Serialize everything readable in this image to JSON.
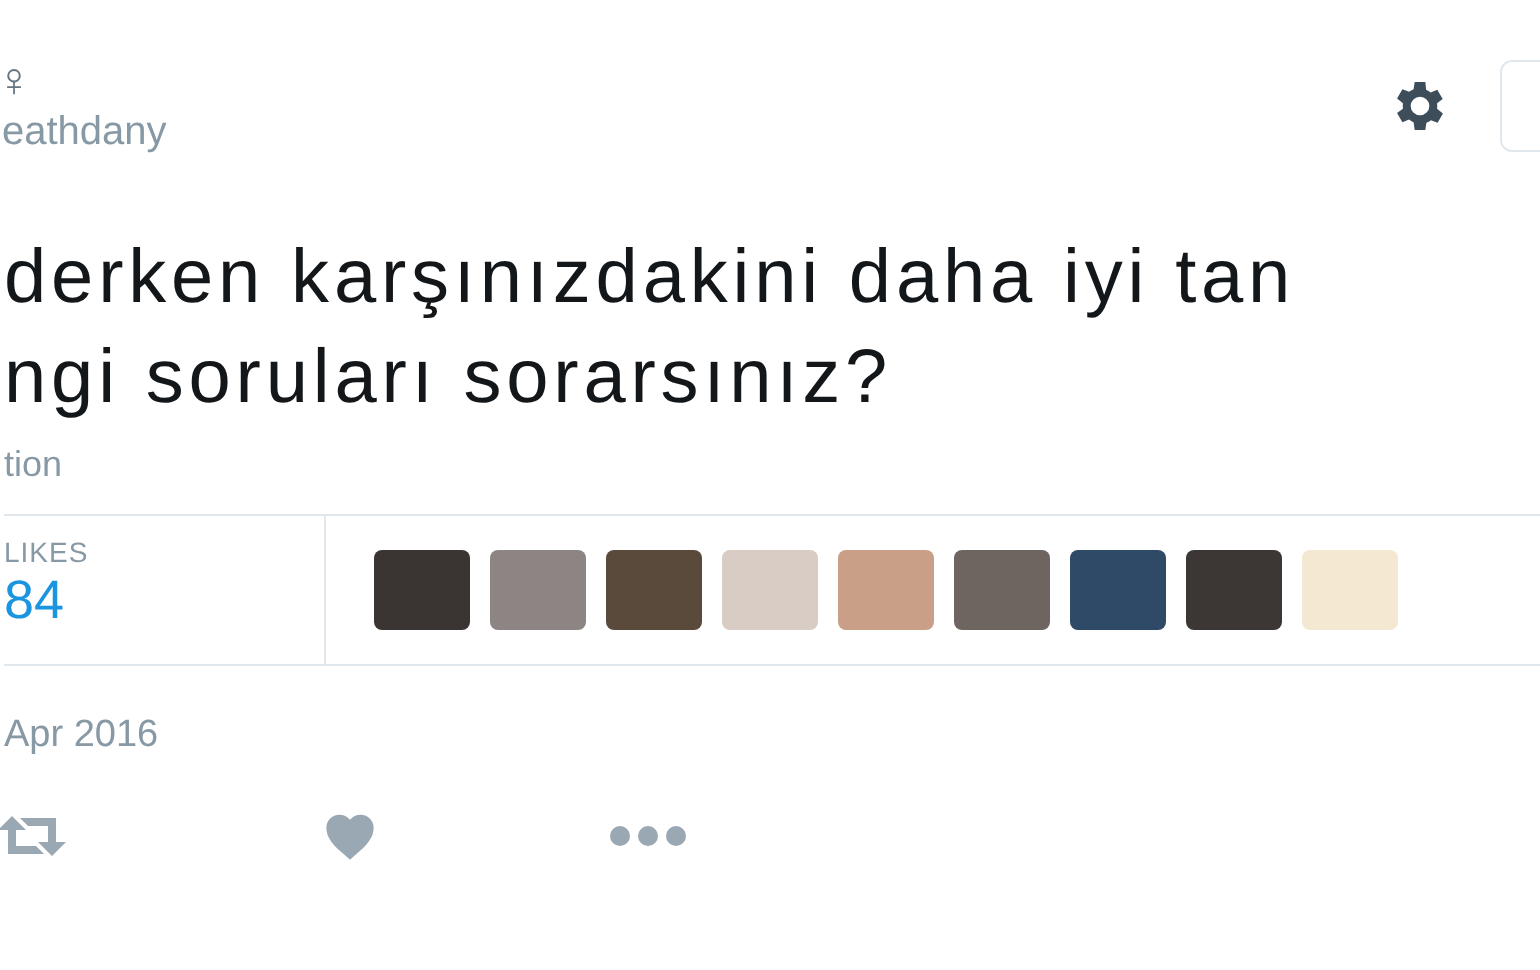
{
  "author": {
    "symbol": "♀",
    "handle": "eathdany"
  },
  "tweet": {
    "lines": [
      "derken karşınızdakini daha iyi tan",
      "ngi soruları sorarsınız?"
    ],
    "translation_link": "tion"
  },
  "stats": {
    "likes_label": "LIKES",
    "likes_count": "84"
  },
  "date": "Apr 2016"
}
